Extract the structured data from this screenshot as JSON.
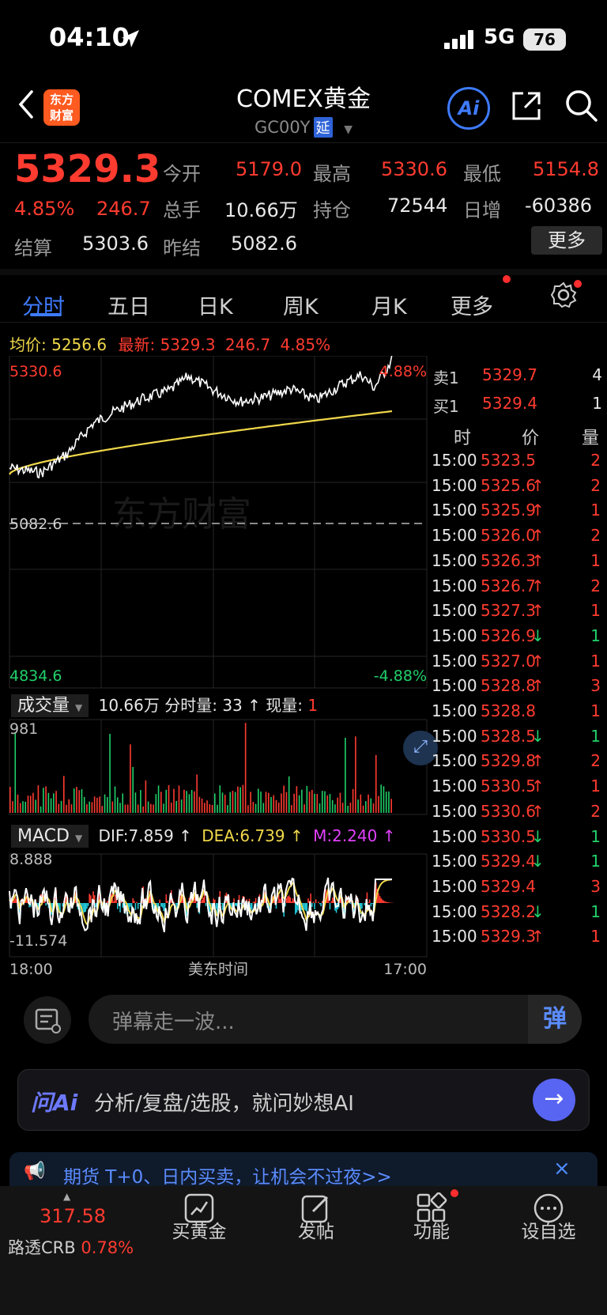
{
  "status": {
    "time": "04:10",
    "network": "5G",
    "battery": "76"
  },
  "header": {
    "title": "COMEX黄金",
    "code": "GC00Y",
    "delay_badge": "延",
    "logo_line1": "东方",
    "logo_line2": "财富",
    "ai_label": "Ai"
  },
  "quote": {
    "price": "5329.3",
    "change_pct": "4.85%",
    "change": "246.7",
    "open_label": "今开",
    "open": "5179.0",
    "high_label": "最高",
    "high": "5330.6",
    "low_label": "最低",
    "low": "5154.8",
    "volume_label": "总手",
    "volume": "10.66万",
    "oi_label": "持仓",
    "oi": "72544",
    "oi_change_label": "日增",
    "oi_change": "-60386",
    "settle_label": "结算",
    "settle": "5303.6",
    "prev_settle_label": "昨结",
    "prev_settle": "5082.6",
    "more_button": "更多"
  },
  "tabs": [
    "分时",
    "五日",
    "日K",
    "周K",
    "月K",
    "更多"
  ],
  "summary": {
    "avg_label": "均价:",
    "avg": "5256.6",
    "last_label": "最新:",
    "last": "5329.3",
    "change": "246.7",
    "pct": "4.85%"
  },
  "chart": {
    "y_top": "5330.6",
    "y_mid": "5082.6",
    "y_bottom": "4834.6",
    "pct_top": "4.88%",
    "pct_bottom": "-4.88%",
    "watermark": "东方财富",
    "volume_tag": "成交量",
    "volume_text": "10.66万 分时量: 33 ↑ 现量:",
    "volume_now": "1",
    "volume_max": "981",
    "macd_tag": "MACD",
    "dif": "DIF:7.859 ↑",
    "dea": "DEA:6.739 ↑",
    "m": "M:2.240 ↑",
    "macd_top": "8.888",
    "macd_bottom": "-11.574",
    "x_start": "18:00",
    "x_mid": "美东时间",
    "x_end": "17:00"
  },
  "book": {
    "ask_label": "卖1",
    "ask_price": "5329.7",
    "ask_qty": "4",
    "bid_label": "买1",
    "bid_price": "5329.4",
    "bid_qty": "1",
    "head_time": "时",
    "head_price": "价",
    "head_qty": "量",
    "trades": [
      {
        "t": "15:00",
        "p": "5323.5",
        "d": "",
        "q": "2",
        "c": "red"
      },
      {
        "t": "15:00",
        "p": "5325.6",
        "d": "↑",
        "q": "2",
        "c": "red"
      },
      {
        "t": "15:00",
        "p": "5325.9",
        "d": "↑",
        "q": "1",
        "c": "red"
      },
      {
        "t": "15:00",
        "p": "5326.0",
        "d": "↑",
        "q": "2",
        "c": "red"
      },
      {
        "t": "15:00",
        "p": "5326.3",
        "d": "↑",
        "q": "1",
        "c": "red"
      },
      {
        "t": "15:00",
        "p": "5326.7",
        "d": "↑",
        "q": "2",
        "c": "red"
      },
      {
        "t": "15:00",
        "p": "5327.3",
        "d": "↑",
        "q": "1",
        "c": "red"
      },
      {
        "t": "15:00",
        "p": "5326.9",
        "d": "↓",
        "q": "1",
        "c": "green"
      },
      {
        "t": "15:00",
        "p": "5327.0",
        "d": "↑",
        "q": "1",
        "c": "red"
      },
      {
        "t": "15:00",
        "p": "5328.8",
        "d": "↑",
        "q": "3",
        "c": "red"
      },
      {
        "t": "15:00",
        "p": "5328.8",
        "d": "",
        "q": "1",
        "c": "red"
      },
      {
        "t": "15:00",
        "p": "5328.5",
        "d": "↓",
        "q": "1",
        "c": "green"
      },
      {
        "t": "15:00",
        "p": "5329.8",
        "d": "↑",
        "q": "2",
        "c": "red"
      },
      {
        "t": "15:00",
        "p": "5330.5",
        "d": "↑",
        "q": "1",
        "c": "red"
      },
      {
        "t": "15:00",
        "p": "5330.6",
        "d": "↑",
        "q": "2",
        "c": "red"
      },
      {
        "t": "15:00",
        "p": "5330.5",
        "d": "↓",
        "q": "1",
        "c": "green"
      },
      {
        "t": "15:00",
        "p": "5329.4",
        "d": "↓",
        "q": "1",
        "c": "green"
      },
      {
        "t": "15:00",
        "p": "5329.4",
        "d": "",
        "q": "3",
        "c": "red"
      },
      {
        "t": "15:00",
        "p": "5328.2",
        "d": "↓",
        "q": "1",
        "c": "green"
      },
      {
        "t": "15:00",
        "p": "5329.3",
        "d": "↑",
        "q": "1",
        "c": "red"
      }
    ]
  },
  "danmu": {
    "placeholder": "弹幕走一波...",
    "send": "弹"
  },
  "ask": {
    "brand": "问Ai",
    "text": "分析/复盘/选股，就问妙想AI",
    "go": "→"
  },
  "notice": {
    "text": "期货 T+0、日内买卖，让机会不过夜>>",
    "close": "×"
  },
  "bottom_nav": {
    "crb_value": "317.58",
    "crb_label": "路透CRB",
    "crb_pct": "0.78%",
    "items": [
      "买黄金",
      "发帖",
      "功能",
      "设自选"
    ]
  },
  "colors": {
    "up": "#ff3b30",
    "down": "#21d06a",
    "accent": "#3e7bff",
    "avg": "#f0d84a"
  }
}
